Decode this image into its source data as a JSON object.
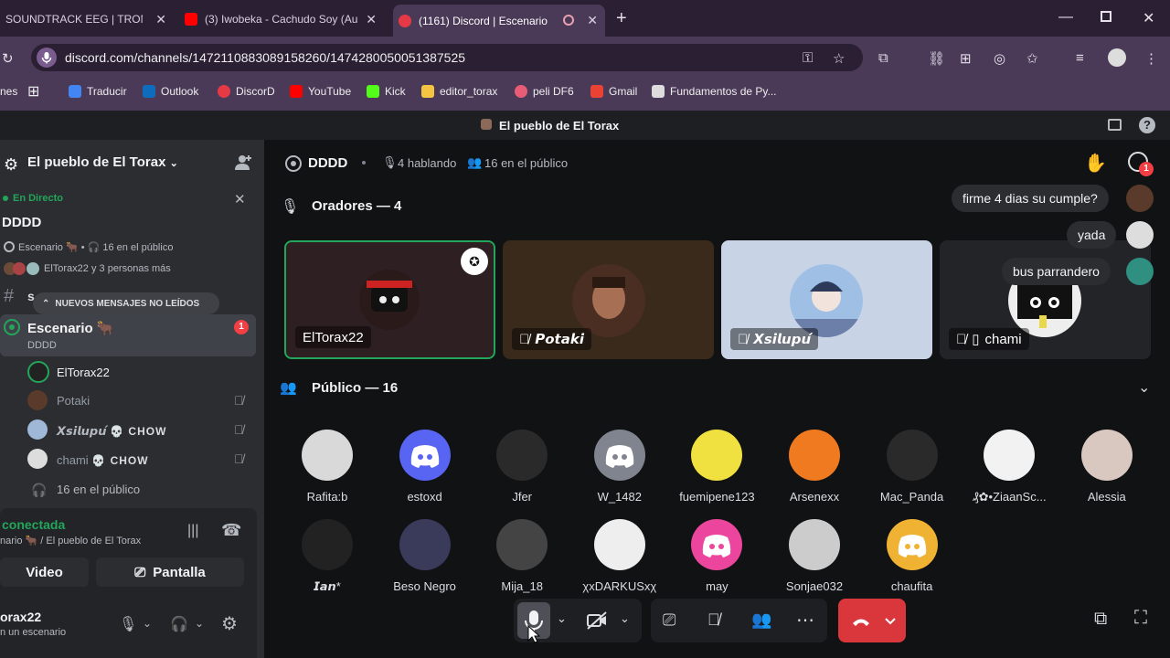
{
  "browser": {
    "tabs": [
      {
        "title": "SOUNDTRACK EEG | TROMP",
        "active": false
      },
      {
        "title": "(3) Iwobeka - Cachudo Soy (Au",
        "active": false
      },
      {
        "title": "(1161) Discord | Escenario",
        "active": true
      }
    ],
    "url": "discord.com/channels/1472110883089158260/1474280050051387525",
    "bookmarks": [
      "nes",
      "Traducir",
      "Outlook",
      "DiscorD",
      "YouTube",
      "Kick",
      "editor_torax",
      "peli DF6",
      "Gmail",
      "Fundamentos de Py..."
    ]
  },
  "window_title": "El pueblo de El Torax",
  "sidebar": {
    "server_name": "El pueblo de El Torax",
    "live_label": "En Directo",
    "stage_title": "DDDD",
    "stage_meta": "Escenario 🐂 • 🎧 16 en el público",
    "stage_people": "ElTorax22 y 3 personas más",
    "new_messages": "NUEVOS MENSAJES NO LEÍDOS",
    "channel_prefix": "s",
    "stage_channel": {
      "name": "Escenario 🐂",
      "sub": "DDDD",
      "badge": "1"
    },
    "members": [
      {
        "name": "ElTorax22",
        "tag": ""
      },
      {
        "name": "Potaki",
        "tag": ""
      },
      {
        "name": "𝙓𝙨𝙞𝙡𝙪𝙥𝙪́",
        "tag": "💀 CHOW"
      },
      {
        "name": "chami",
        "tag": "💀 CHOW"
      }
    ],
    "audience_count": "16 en el público",
    "voice_status": "conectada",
    "voice_location": "nario 🐂 / El pueblo de El Torax",
    "video_label": "Video",
    "screen_label": "Pantalla",
    "username": "orax22",
    "user_status": "n un escenario"
  },
  "main": {
    "stage_name": "DDDD",
    "speaking": "4 hablando",
    "audience": "16 en el público",
    "hand_badge": "1",
    "speakers_header": "Oradores — 4",
    "speakers": [
      {
        "name": "ElTorax22",
        "muted": false,
        "mobile": false
      },
      {
        "name": "𝙋𝙤𝙩𝙖𝙠𝙞",
        "muted": true,
        "mobile": false
      },
      {
        "name": "𝙓𝙨𝙞𝙡𝙪𝙥𝙪́",
        "muted": true,
        "mobile": false
      },
      {
        "name": "chami",
        "muted": true,
        "mobile": true
      }
    ],
    "audience_header": "Público — 16",
    "audience_members": [
      "Rafita:b",
      "estoxd",
      "Jfer",
      "W_1482",
      "fuemipene123",
      "Arsenexx",
      "Mac_Panda",
      "₰✿•ZiaanSc...",
      "Alessia",
      "𝙄𝙖𝙣*",
      "Beso Negro",
      "Mija_18",
      "χxDARKUSxχ",
      "may",
      "Sonjae032",
      "chaufita"
    ],
    "chat_bubbles": [
      "firme 4 dias su cumple?",
      "yada",
      "bus parrandero"
    ]
  },
  "colors": {
    "accent_green": "#23a55a",
    "danger_red": "#da373c",
    "discord_blurple": "#5865f2"
  }
}
